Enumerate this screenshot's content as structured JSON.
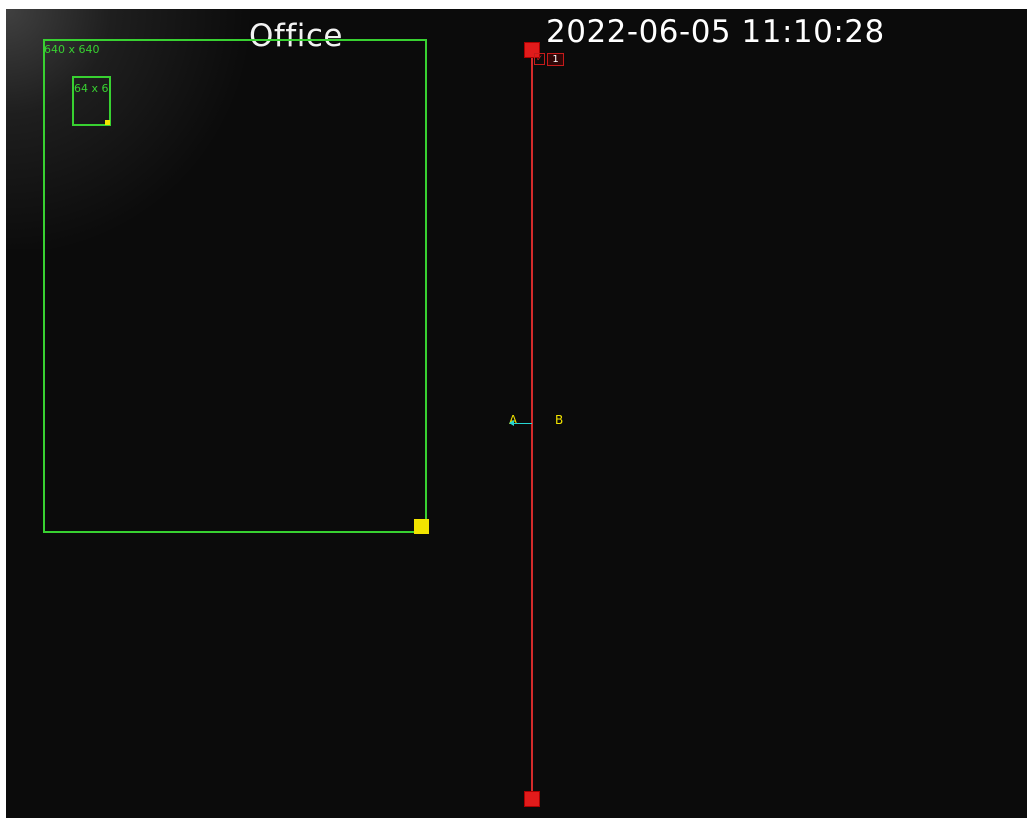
{
  "osd": {
    "title": "Office",
    "timestamp": "2022-06-05 11:10:28"
  },
  "detection": {
    "max_box": {
      "label": "640 x 640"
    },
    "min_box": {
      "label": "64 x 6"
    }
  },
  "line_crossing": {
    "rule_index": "1",
    "check_mark": "✓",
    "side_a": "A",
    "side_b": "B"
  },
  "colors": {
    "box": "#38d131",
    "line": "#d42b2b",
    "handle": "#f2e400",
    "arrow": "#27d7d3"
  },
  "icons": {
    "resize_handle": "square",
    "line_endpoint": "square",
    "direction": "arrow-left"
  }
}
